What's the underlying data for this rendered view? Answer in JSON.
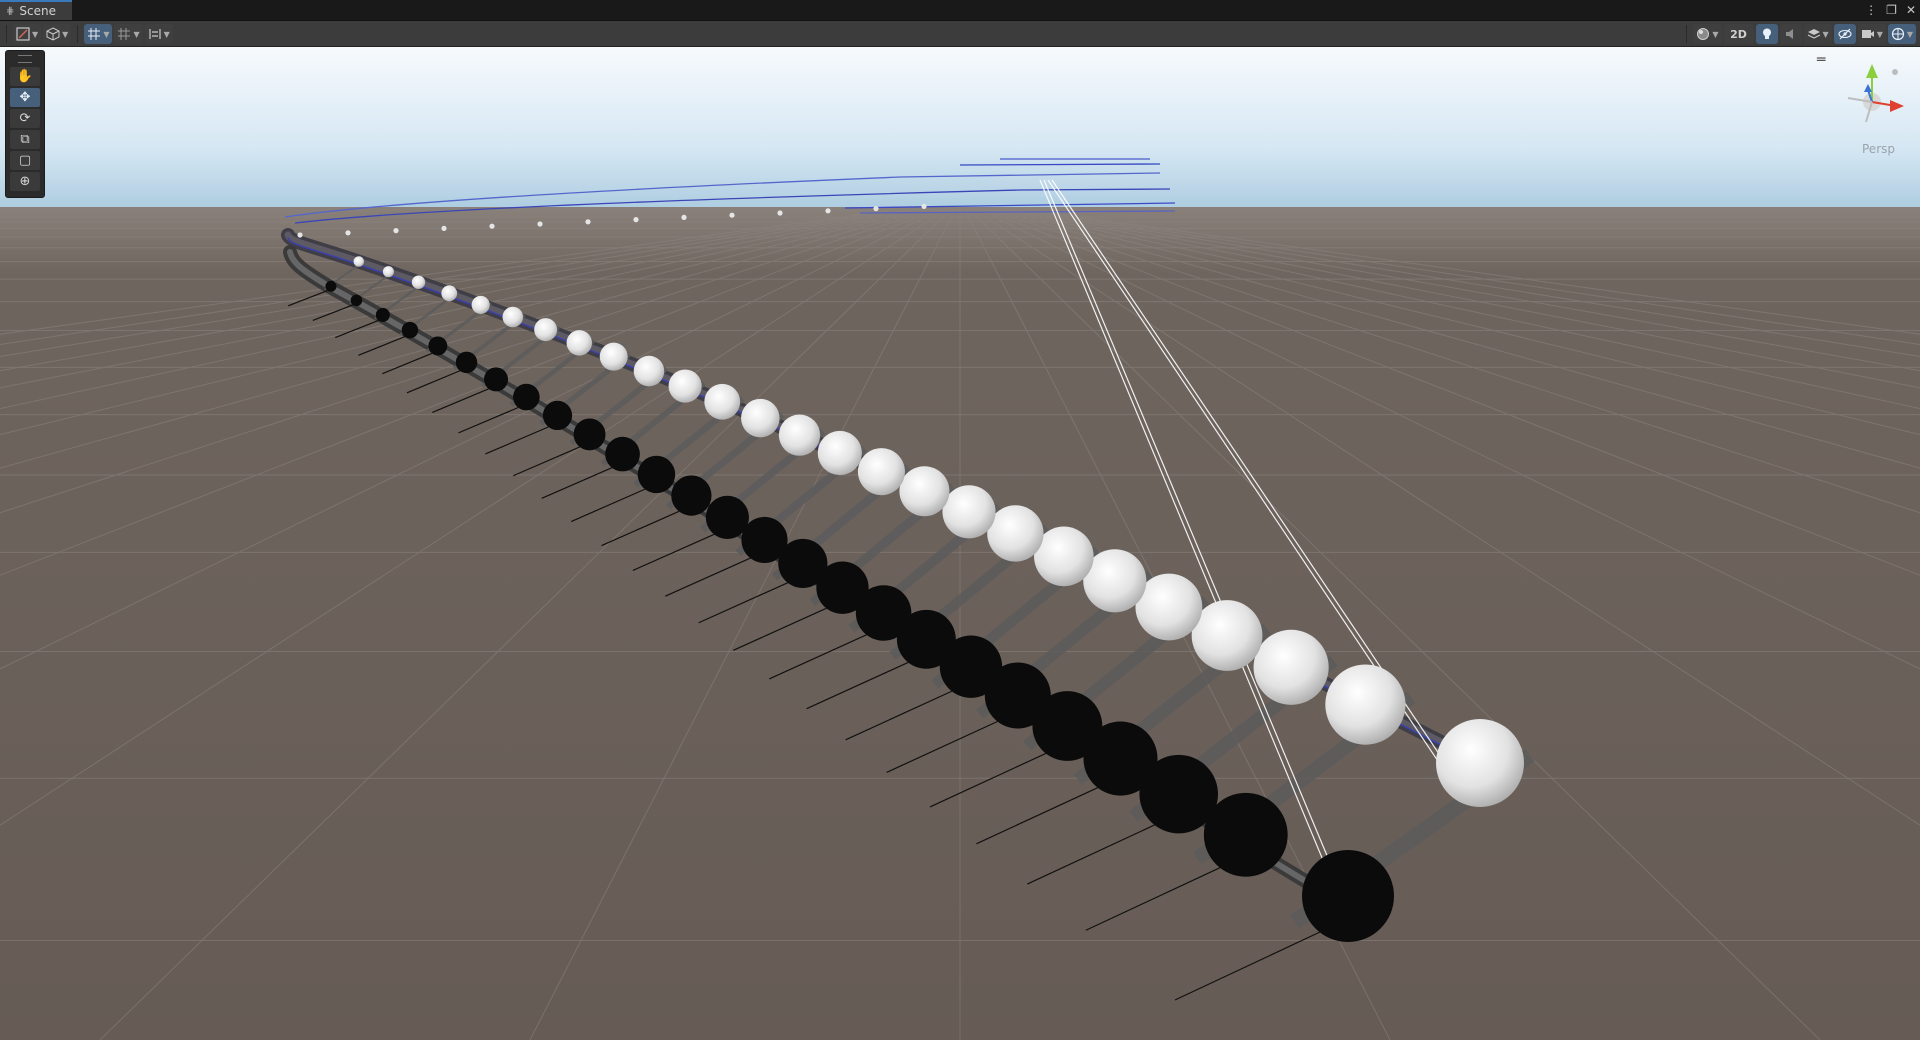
{
  "tab": {
    "title": "Scene",
    "icon": "grid-icon"
  },
  "window_controls": [
    "more-icon",
    "maximize-icon",
    "close-icon"
  ],
  "toolbar": {
    "left": [
      {
        "name": "draw-mode-button",
        "icon": "shading-icon",
        "dropdown": true
      },
      {
        "name": "render-mode-button",
        "icon": "cube-icon",
        "dropdown": true
      },
      {
        "name": "grid-snap-button",
        "icon": "grid-snap-icon",
        "dropdown": true,
        "active": true
      },
      {
        "name": "increment-snap-button",
        "icon": "snap-increment-icon",
        "dropdown": true
      },
      {
        "name": "align-button",
        "icon": "align-icon",
        "dropdown": true
      }
    ],
    "right": {
      "lighting_icon": "sphere-shading-icon",
      "mode_2d_label": "2D",
      "light_icon": "lightbulb-icon",
      "audio_icon": "audio-icon",
      "effects_icon": "effects-layers-icon",
      "visibility_icon": "hidden-visibility-icon",
      "camera_icon": "camera-settings-icon",
      "gizmos_icon": "gizmos-icon"
    }
  },
  "tools": [
    {
      "name": "hand-tool",
      "icon": "hand-icon",
      "active": false
    },
    {
      "name": "move-tool",
      "icon": "move-icon",
      "active": true
    },
    {
      "name": "rotate-tool",
      "icon": "rotate-icon",
      "active": false
    },
    {
      "name": "scale-tool",
      "icon": "scale-icon",
      "active": false
    },
    {
      "name": "rect-tool",
      "icon": "rect-icon",
      "active": false
    },
    {
      "name": "transform-tool",
      "icon": "transform-icon",
      "active": false
    }
  ],
  "gizmo": {
    "projection_label": "Persp",
    "axes": {
      "x": "#e0402f",
      "y": "#8bcf3c",
      "z": "#3a72d6"
    }
  },
  "colors": {
    "sky_top": "#f6f9fc",
    "sky_horizon": "#a9cfe6",
    "ground": "#6b605a",
    "accent": "#3a79bb",
    "track_rail": "#4a4a4a",
    "track_blue": "#2c3ed0",
    "sphere_white": "#e8e8e8",
    "sphere_black": "#0b0b0b"
  }
}
